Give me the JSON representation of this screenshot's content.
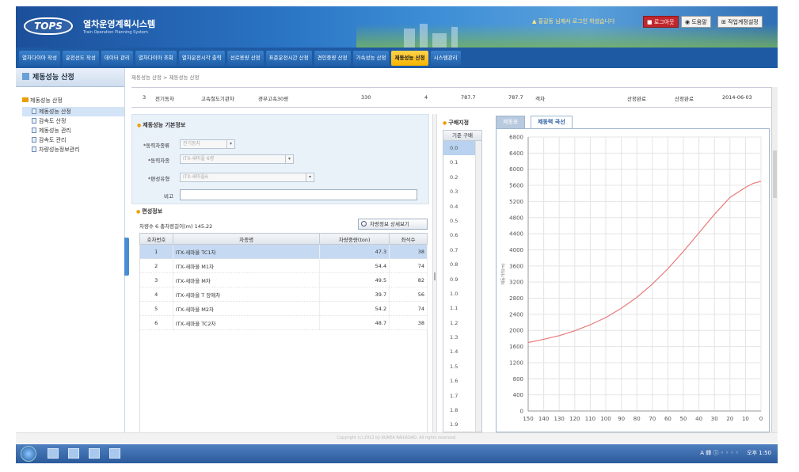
{
  "header": {
    "logo": "TOPS",
    "title": "열차운영계획시스템",
    "subtitle": "Train Operation Planning System",
    "message": "▲ 홍길동 님께서 로그인 하셨습니다",
    "buttons": [
      "■ 로그아웃",
      "◉ 도움말",
      "⊞ 작업계정설정"
    ]
  },
  "nav": {
    "tabs": [
      "열차다이아 작성",
      "운전선도 작성",
      "데이터 관리",
      "열차다이아 조회",
      "열차운전시각 출력",
      "선로용량 산정",
      "표준운전시간 산정",
      "견인중량 산정",
      "가속성능 산정",
      "제동성능 산정",
      "시스템관리"
    ],
    "active_index": 9
  },
  "sidebar": {
    "title": "제동성능 산정",
    "group": "제동성능 산정",
    "items": [
      "제동성능 산정",
      "감속도 산정",
      "제동성능 관리",
      "감속도 관리",
      "차량성능정보관리"
    ],
    "selected_index": 0
  },
  "breadcrumb": "제동성능 산정 > 제동성능 산정",
  "top_row": {
    "no": "3",
    "type": "전기동차",
    "class": "고속철도기관차",
    "route": "경부고속30량",
    "v1": "330",
    "v2": "4",
    "v3": "787.7",
    "v4": "787.7",
    "col": "객차",
    "status1": "산정완료",
    "status2": "산정완료",
    "date": "2014-06-03"
  },
  "basic": {
    "section_title": "제동성능 기본정보",
    "power_type_label": "*동력차종류",
    "power_type_value": "전기동차",
    "power_model_label": "*동력차종",
    "power_model_value": "ITX-새마을 6량",
    "formation_label": "*편성유형",
    "formation_value": "ITX-새마을6",
    "note_label": "비고",
    "note_value": ""
  },
  "formation": {
    "section_title": "편성정보",
    "summary": "차량수 6  총차량길이(m) 145.22",
    "detail_button": "차량정보 상세보기",
    "columns": [
      "호차번호",
      "차종명",
      "차량중량(ton)",
      "좌석수"
    ],
    "rows": [
      [
        "1",
        "ITX-새마을 TC1차",
        "47.3",
        "38"
      ],
      [
        "2",
        "ITX-새마을 M1차",
        "54.4",
        "74"
      ],
      [
        "3",
        "ITX-새마을 M차",
        "49.5",
        "82"
      ],
      [
        "4",
        "ITX-새마을 T 장애차",
        "39.7",
        "56"
      ],
      [
        "5",
        "ITX-새마을 M2차",
        "54.2",
        "74"
      ],
      [
        "6",
        "ITX-새마을 TC2차",
        "48.7",
        "38"
      ]
    ],
    "selected_row": 0
  },
  "gradient": {
    "section_title": "구배지정",
    "header": "기준 구배",
    "values": [
      "0.0",
      "0.1",
      "0.2",
      "0.3",
      "0.4",
      "0.5",
      "0.6",
      "0.7",
      "0.8",
      "0.9",
      "1.0",
      "1.1",
      "1.2",
      "1.3",
      "1.4",
      "1.5",
      "1.6",
      "1.7",
      "1.8",
      "1.9"
    ],
    "selected_index": 0
  },
  "chart_tabs": [
    "제동표",
    "제동력 곡선"
  ],
  "chart_tab_active": 1,
  "chart_data": {
    "type": "line",
    "title": "",
    "xlabel": "",
    "ylabel": "제동거리(m)",
    "x_ticks": [
      150,
      140,
      130,
      120,
      110,
      100,
      90,
      80,
      70,
      60,
      50,
      40,
      30,
      20,
      10,
      0
    ],
    "y_ticks": [
      0,
      400,
      800,
      1200,
      1600,
      2000,
      2400,
      2800,
      3200,
      3600,
      4000,
      4400,
      4800,
      5200,
      5600,
      6000,
      6400,
      6800
    ],
    "xlim": [
      150,
      0
    ],
    "ylim": [
      0,
      6800
    ],
    "grid": true,
    "series": [
      {
        "color": "#e77a7a",
        "x": [
          150,
          140,
          130,
          120,
          110,
          100,
          90,
          80,
          70,
          60,
          50,
          40,
          30,
          20,
          10,
          5,
          0
        ],
        "y": [
          1700,
          1780,
          1870,
          1990,
          2140,
          2320,
          2550,
          2820,
          3150,
          3530,
          3960,
          4420,
          4880,
          5300,
          5550,
          5650,
          5700
        ]
      }
    ]
  },
  "footer": "Copyright (c) 2012 by KOREA RAILROAD. All rights reserved.",
  "taskbar": {
    "tray_text": "A 韓 ⓘ ◦ ◦ ◦ ◦",
    "clock": "오후 1:50"
  }
}
